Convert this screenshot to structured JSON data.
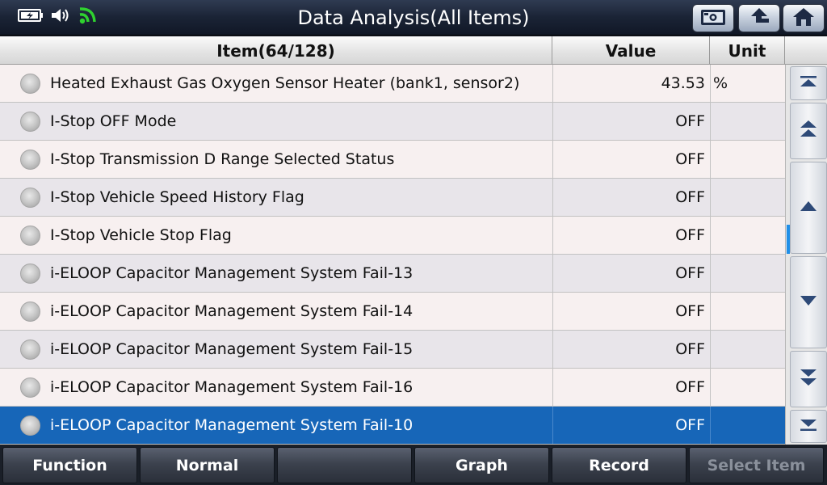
{
  "header": {
    "title": "Data Analysis(All Items)"
  },
  "table": {
    "columns": {
      "item": "Item(64/128)",
      "value": "Value",
      "unit": "Unit"
    },
    "rows": [
      {
        "name": "Heated Exhaust Gas Oxygen Sensor Heater (bank1, sensor2)",
        "value": "43.53",
        "unit": "%"
      },
      {
        "name": "I-Stop OFF Mode",
        "value": "OFF",
        "unit": ""
      },
      {
        "name": "I-Stop Transmission D Range Selected Status",
        "value": "OFF",
        "unit": ""
      },
      {
        "name": "I-Stop Vehicle Speed History Flag",
        "value": "OFF",
        "unit": ""
      },
      {
        "name": "I-Stop Vehicle Stop Flag",
        "value": "OFF",
        "unit": ""
      },
      {
        "name": "i-ELOOP Capacitor Management System Fail-13",
        "value": "OFF",
        "unit": ""
      },
      {
        "name": "i-ELOOP Capacitor Management System Fail-14",
        "value": "OFF",
        "unit": ""
      },
      {
        "name": "i-ELOOP Capacitor Management System Fail-15",
        "value": "OFF",
        "unit": ""
      },
      {
        "name": "i-ELOOP Capacitor Management System Fail-16",
        "value": "OFF",
        "unit": ""
      },
      {
        "name": "i-ELOOP Capacitor Management System Fail-10",
        "value": "OFF",
        "unit": ""
      }
    ],
    "selected_row": 9
  },
  "bottombar": {
    "function": "Function",
    "normal": "Normal",
    "empty": "",
    "graph": "Graph",
    "record": "Record",
    "select_item": "Select Item"
  },
  "colors": {
    "selected_row": "#1766b8",
    "wifi": "#2fd12f",
    "scroll_indicator": "#1f8fe8"
  }
}
